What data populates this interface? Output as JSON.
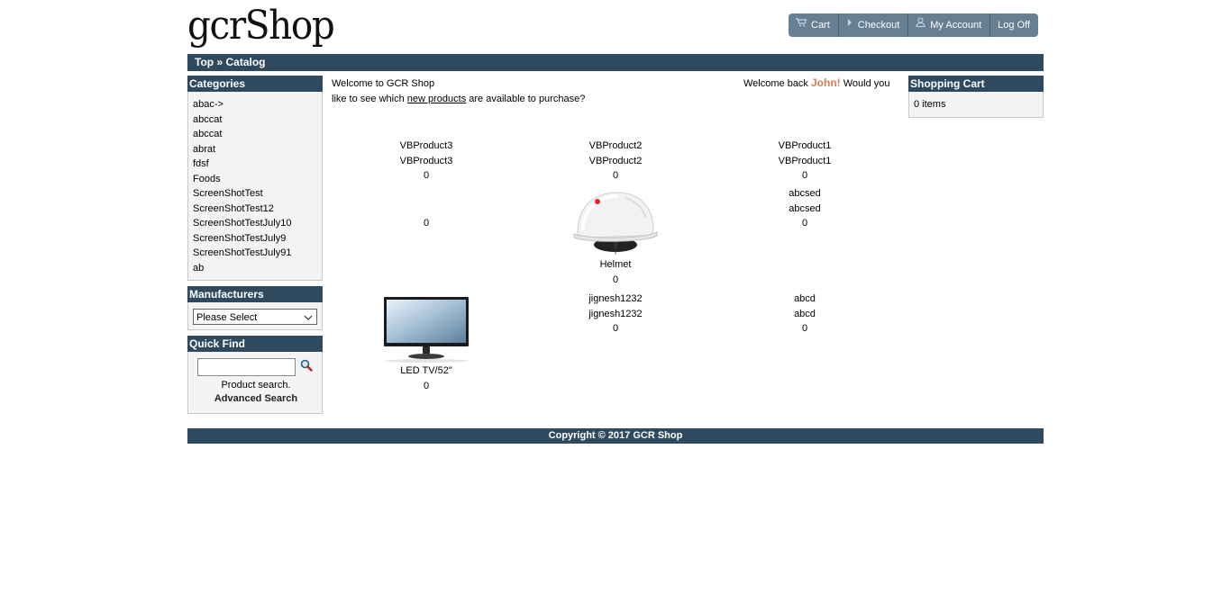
{
  "header": {
    "logo_text": "gcrShop",
    "nav": [
      {
        "label": "Cart",
        "icon": "cart-icon"
      },
      {
        "label": "Checkout",
        "icon": "triangle-right-icon"
      },
      {
        "label": "My Account",
        "icon": "user-icon"
      },
      {
        "label": "Log Off",
        "icon": ""
      }
    ]
  },
  "breadcrumb": {
    "top": "Top",
    "separator": "»",
    "current": "Catalog"
  },
  "categories": {
    "title": "Categories",
    "items": [
      "abac->",
      "abccat",
      "abccat",
      "abrat",
      "fdsf",
      "Foods",
      "ScreenShotTest",
      "ScreenShotTest12",
      "ScreenShotTestJuly10",
      "ScreenShotTestJuly9",
      "ScreenShotTestJuly91",
      "ab"
    ]
  },
  "manufacturers": {
    "title": "Manufacturers",
    "selected": "Please Select"
  },
  "quick_find": {
    "title": "Quick Find",
    "input_value": "",
    "caption": "Product search.",
    "advanced_label": "Advanced Search"
  },
  "welcome": {
    "heading": "Welcome to GCR Shop",
    "prefix": "Welcome back",
    "name": "John!",
    "suffix": "Would you",
    "line2_pre": "like to see which",
    "link": "new products",
    "line2_post": "are available to purchase?"
  },
  "products": [
    {
      "name": "VBProduct3",
      "name2": "VBProduct3",
      "price": "0"
    },
    {
      "name": "VBProduct2",
      "name2": "VBProduct2",
      "price": "0"
    },
    {
      "name": "VBProduct1",
      "name2": "VBProduct1",
      "price": "0"
    },
    {
      "price": "0"
    },
    {
      "name": "Helmet",
      "price": "0"
    },
    {
      "name": "abcsed",
      "name2": "abcsed",
      "price": "0"
    },
    {
      "name": "LED TV/52\"",
      "price": "0"
    },
    {
      "name": "jignesh1232",
      "name2": "jignesh1232",
      "price": "0"
    },
    {
      "name": "abcd",
      "name2": "abcd",
      "price": "0"
    }
  ],
  "shopping_cart": {
    "title": "Shopping Cart",
    "contents": "0 items"
  },
  "footer": {
    "text": "Copyright © 2017 GCR Shop"
  },
  "colors": {
    "bar": "#2f4a5e",
    "nav_button": "#667f93",
    "accent_name": "#e07a5a"
  }
}
